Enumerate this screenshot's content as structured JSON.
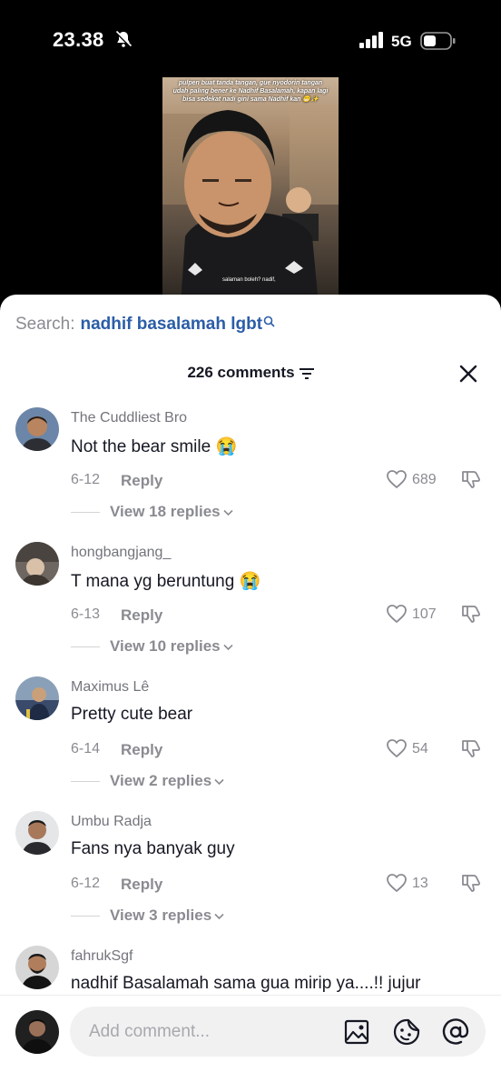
{
  "status_bar": {
    "time": "23.38",
    "network": "5G"
  },
  "video": {
    "caption": "pulpen buat tanda tangan, gue nyodorin tangan udah paling bener ke Nadhif Basalamah, kapan lagi bisa sedekat nadi gini sama Nadhif kan 😁✨",
    "bottom_text": "salaman boleh? nadif,"
  },
  "search": {
    "label": "Search:",
    "query": "nadhif basalamah lgbt"
  },
  "comments_header": {
    "title": "226 comments"
  },
  "comments": [
    {
      "username": "The Cuddliest Bro",
      "text": "Not the bear smile 😭",
      "date": "6-12",
      "reply_label": "Reply",
      "likes": "689",
      "view_replies": "View 18 replies",
      "avatar_color": "#6b86a8"
    },
    {
      "username": "hongbangjang_",
      "text": "T mana yg beruntung 😭",
      "date": "6-13",
      "reply_label": "Reply",
      "likes": "107",
      "view_replies": "View 10 replies",
      "avatar_color": "#6e6660"
    },
    {
      "username": "Maximus Lê",
      "text": "Pretty cute bear",
      "date": "6-14",
      "reply_label": "Reply",
      "likes": "54",
      "view_replies": "View 2 replies",
      "avatar_color": "#3a4a6b"
    },
    {
      "username": "Umbu Radja",
      "text": "Fans nya banyak guy",
      "date": "6-12",
      "reply_label": "Reply",
      "likes": "13",
      "view_replies": "View 3 replies",
      "avatar_color": "#b9bcc0"
    },
    {
      "username": "fahrukSgf",
      "text": "nadhif Basalamah sama gua mirip ya....!! jujur",
      "avatar_color": "#2b2b2b"
    }
  ],
  "composer": {
    "placeholder": "Add comment..."
  },
  "colors": {
    "accent_link": "#2b5da8",
    "muted_text": "#8a8b91",
    "primary_text": "#161823"
  }
}
